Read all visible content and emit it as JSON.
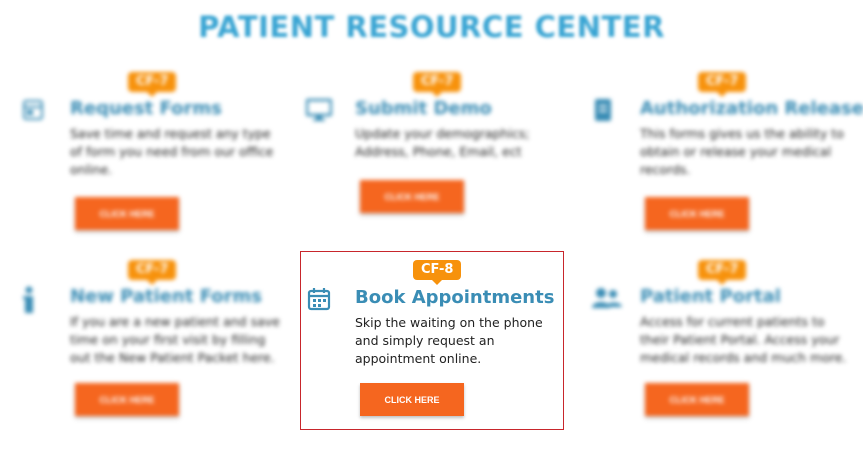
{
  "header": {
    "title": "PATIENT RESOURCE CENTER"
  },
  "colors": {
    "accent": "#3aa5d3",
    "title_blue": "#3a8db5",
    "button": "#f5661f",
    "badge": "#f7920c",
    "focus_border": "#c8262c"
  },
  "cards": [
    {
      "badge": "CF-7",
      "icon": "form-icon",
      "title": "Request Forms",
      "description": "Save time and request any type of form you need from our office online.",
      "button": "CLICK HERE"
    },
    {
      "badge": "CF-7",
      "icon": "monitor-icon",
      "title": "Submit Demo",
      "description": "Update your demographics; Address, Phone, Email, ect",
      "button": "CLICK HERE"
    },
    {
      "badge": "CF-7",
      "icon": "document-icon",
      "title": "Authorization Release",
      "description": "This forms gives us the ability to obtain or release your medical records.",
      "button": "CLICK HERE"
    },
    {
      "badge": "CF-7",
      "icon": "info-icon",
      "title": "New Patient Forms",
      "description": "If you are a new patient and save time on your first visit by filling out the New Patient Packet here.",
      "button": "CLICK HERE"
    },
    {
      "badge": "CF-8",
      "icon": "calendar-icon",
      "title": "Book Appointments",
      "description": "Skip the waiting on the phone and simply request an appointment online.",
      "button": "CLICK HERE"
    },
    {
      "badge": "CF-7",
      "icon": "users-icon",
      "title": "Patient Portal",
      "description": "Access for current patients to their Patient Portal. Access your medical records and much more.",
      "button": "CLICK HERE"
    }
  ]
}
